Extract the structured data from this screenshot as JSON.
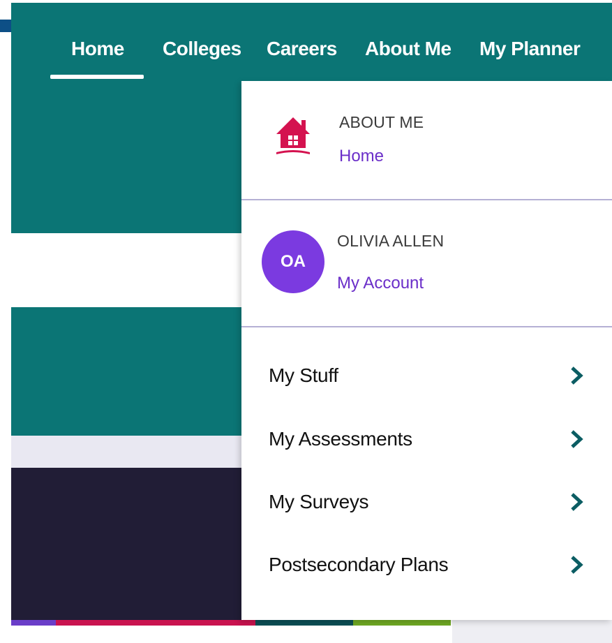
{
  "nav": {
    "items": [
      {
        "label": "Home",
        "active": true
      },
      {
        "label": "Colleges"
      },
      {
        "label": "Careers"
      },
      {
        "label": "About Me"
      },
      {
        "label": "My Planner"
      }
    ]
  },
  "dropdown": {
    "about": {
      "label": "ABOUT ME",
      "link": "Home",
      "icon": "house-icon"
    },
    "account": {
      "initials": "OA",
      "name": "OLIVIA ALLEN",
      "link": "My Account"
    },
    "menu": [
      {
        "label": "My Stuff",
        "icon": "chevron-right-icon"
      },
      {
        "label": "My Assessments",
        "icon": "chevron-right-icon"
      },
      {
        "label": "My Surveys",
        "icon": "chevron-right-icon"
      },
      {
        "label": "Postsecondary Plans",
        "icon": "chevron-right-icon"
      }
    ]
  },
  "colors": {
    "nav_bg": "#0b7575",
    "link": "#6b2fc9",
    "avatar": "#7b3ae0",
    "house_icon": "#d4124f",
    "chevron": "#0b5d63",
    "divider": "#b5b0d4",
    "navy_block": "#211d36"
  }
}
